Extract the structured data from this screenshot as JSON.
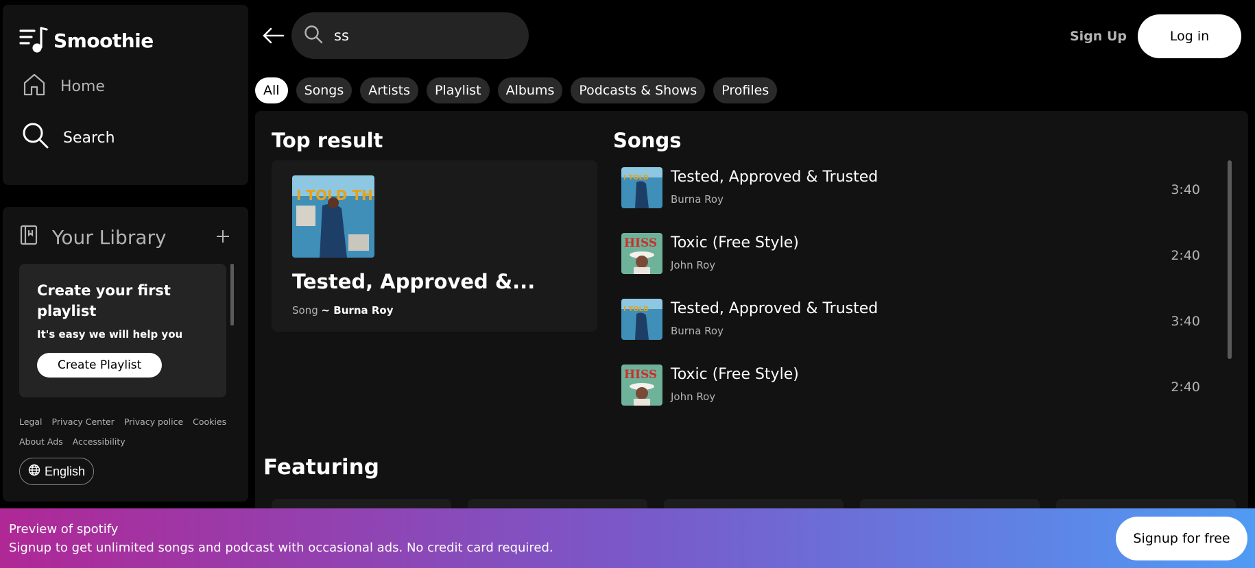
{
  "app": {
    "name": "Smoothie"
  },
  "nav": {
    "home": "Home",
    "search": "Search"
  },
  "library": {
    "title": "Your Library",
    "create_title": "Create your first playlist",
    "create_sub": "It's easy we will help you",
    "create_button": "Create Playlist",
    "footer_links": [
      "Legal",
      "Privacy Center",
      "Privacy police",
      "Cookies",
      "About Ads",
      "Accessibility"
    ],
    "language": "English"
  },
  "header": {
    "search_value": "ss",
    "signup": "Sign Up",
    "login": "Log in"
  },
  "chips": [
    "All",
    "Songs",
    "Artists",
    "Playlist",
    "Albums",
    "Podcasts & Shows",
    "Profiles"
  ],
  "chips_active_index": 0,
  "top_result": {
    "heading": "Top result",
    "title": "Tested, Approved &...",
    "type": "Song",
    "artist": "~ Burna Roy"
  },
  "songs": {
    "heading": "Songs",
    "items": [
      {
        "title": "Tested, Approved & Trusted",
        "artist": "Burna Roy",
        "duration": "3:40",
        "art": "tested"
      },
      {
        "title": "Toxic (Free Style)",
        "artist": "John Roy",
        "duration": "2:40",
        "art": "hiss"
      },
      {
        "title": "Tested, Approved & Trusted",
        "artist": "Burna Roy",
        "duration": "3:40",
        "art": "tested"
      },
      {
        "title": "Toxic (Free Style)",
        "artist": "John Roy",
        "duration": "2:40",
        "art": "hiss"
      }
    ]
  },
  "featuring": {
    "heading": "Featuring"
  },
  "banner": {
    "title": "Preview of spotify",
    "subtitle": "Signup to get unlimited songs and podcast with occasional ads. No credit card required.",
    "button": "Signup for free",
    "gradient": [
      "#af2896",
      "#509bf5"
    ]
  },
  "icons": {
    "logo": "music-note-list-icon",
    "home": "home-icon",
    "search": "search-icon",
    "library": "library-icon",
    "add": "plus-icon",
    "language": "globe-icon",
    "back": "arrow-left-icon"
  }
}
